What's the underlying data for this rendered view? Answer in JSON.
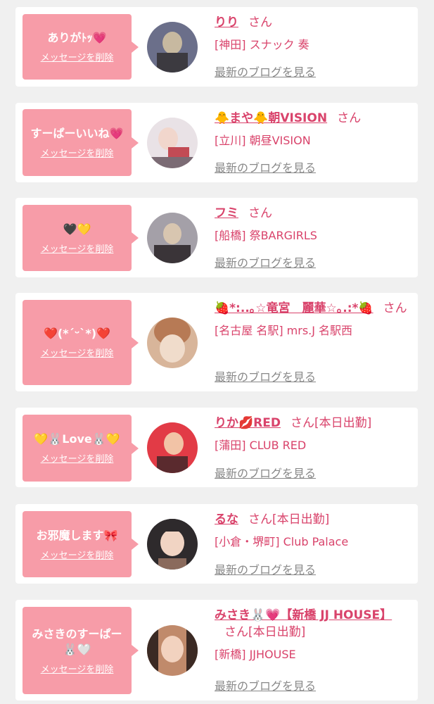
{
  "delete_label": "メッセージを削除",
  "san_label": "さん",
  "blog_label": "最新のブログを見る",
  "colors": {
    "bubble": "#f79ca8",
    "accent": "#d9436b",
    "link_gray": "#888888",
    "background": "#f0f0f0"
  },
  "cards": [
    {
      "message": "ありがﾄｯ💗",
      "name": "りり",
      "shift": "",
      "shop": "[神田] スナック 奏",
      "avatar_palette": [
        "#6b6f8a",
        "#c7b9a0",
        "#3c3a40"
      ]
    },
    {
      "message": "すーぱーいいね💗",
      "name": "🐥まや🐥朝VISION",
      "shift": "",
      "shop": "[立川] 朝昼VISION",
      "avatar_palette": [
        "#e9e2e6",
        "#c24b55",
        "#7b6b74"
      ]
    },
    {
      "message": "🖤💛",
      "name": "フミ",
      "shift": "",
      "shop": "[船橋] 祭BARGIRLS",
      "avatar_palette": [
        "#a4a0a8",
        "#d8c6b0",
        "#3a3438"
      ]
    },
    {
      "message": "❤️(*´ᵕ`*)❤️",
      "name": "🍓*:..｡☆竜宮　麗華☆｡.:*🍓",
      "shift": "",
      "shop": "[名古屋 名駅] mrs.J 名駅西",
      "avatar_palette": [
        "#d8b59a",
        "#b77a55",
        "#f0dccb"
      ]
    },
    {
      "message": "💛🐰Love🐰💛",
      "name": "りか💋RED",
      "shift": "[本日出勤]",
      "shop": "[蒲田] CLUB RED",
      "avatar_palette": [
        "#e23b46",
        "#f2c3a6",
        "#5a2a2e"
      ]
    },
    {
      "message": "お邪魔します🎀",
      "name": "るな",
      "shift": "[本日出勤]",
      "shop": "[小倉・堺町] Club Palace",
      "avatar_palette": [
        "#2e2a2c",
        "#f1d4c3",
        "#8a6a5c"
      ]
    },
    {
      "message": "みさきのすーぱー🐰🤍",
      "name": "みさき🐰💗【新橋 JJ HOUSE】",
      "shift": "[本日出勤]",
      "shop": "[新橋] JJHOUSE",
      "avatar_palette": [
        "#c08a6b",
        "#f2d2bf",
        "#3b2a24"
      ]
    }
  ]
}
